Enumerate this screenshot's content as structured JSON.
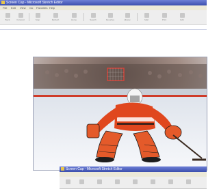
{
  "window": {
    "title": "Screen Cap - Microsoft Stretch Editor",
    "menu": [
      "File",
      "Edit",
      "View",
      "Go",
      "Favorites",
      "Help"
    ],
    "toolbar": [
      "Back",
      "Forward",
      "Stop",
      "Refresh",
      "Home",
      "Search",
      "Favorites",
      "History",
      "Mail",
      "Print",
      "Edit"
    ]
  },
  "second_window": {
    "title": "Screen Cap - Microsoft Stretch Editor"
  },
  "photo": {
    "description_icon": "hockey-goalie-photo"
  },
  "colors": {
    "titlebar": "#4557b8",
    "jersey": "#e0471e",
    "ice": "#f2f4f7"
  }
}
